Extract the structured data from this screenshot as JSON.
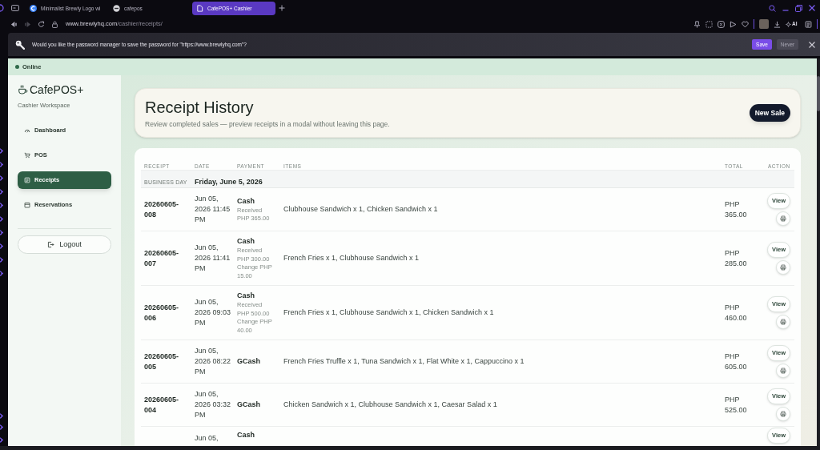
{
  "browser": {
    "tabs": [
      {
        "title": "Minimalist Brewly Logo wi",
        "selected": false
      },
      {
        "title": "cafepos",
        "selected": false
      },
      {
        "title": "CafePOS+ Cashier",
        "selected": true
      }
    ],
    "address": {
      "host": "www.brewlyhq.com",
      "path": "/cashier/receipts/"
    },
    "toolbar": {
      "ai_label": "AI"
    }
  },
  "password_prompt": {
    "message": "Would you like the password manager to save the password for \"https://www.brewlyhq.com\"?",
    "save": "Save",
    "never": "Never"
  },
  "status_bar": {
    "label": "Online"
  },
  "sidebar": {
    "brand": "CafePOS+",
    "subtitle": "Cashier Workspace",
    "items": [
      {
        "label": "Dashboard",
        "selected": false
      },
      {
        "label": "POS",
        "selected": false
      },
      {
        "label": "Receipts",
        "selected": true
      },
      {
        "label": "Reservations",
        "selected": false
      }
    ],
    "logout": "Logout"
  },
  "header": {
    "title": "Receipt History",
    "subtitle": "Review completed sales — preview receipts in a modal without leaving this page.",
    "button": "New Sale"
  },
  "table": {
    "columns": [
      "RECEIPT",
      "DATE",
      "PAYMENT",
      "ITEMS",
      "TOTAL",
      "ACTION"
    ],
    "group": {
      "label": "BUSINESS DAY",
      "date": "Friday, June 5, 2026"
    },
    "rows": [
      {
        "receipt": "20260605-008",
        "date": "Jun 05, 2026 11:45 PM",
        "payment": {
          "method": "Cash",
          "received": "Received PHP 365.00"
        },
        "items": "Clubhouse Sandwich x 1, Chicken Sandwich x 1",
        "total": "PHP 365.00",
        "action": "View"
      },
      {
        "receipt": "20260605-007",
        "date": "Jun 05, 2026 11:41 PM",
        "payment": {
          "method": "Cash",
          "received": "Received PHP 300.00",
          "change": "Change PHP 15.00"
        },
        "items": "French Fries x 1, Clubhouse Sandwich x 1",
        "total": "PHP 285.00",
        "action": "View"
      },
      {
        "receipt": "20260605-006",
        "date": "Jun 05, 2026 09:03 PM",
        "payment": {
          "method": "Cash",
          "received": "Received PHP 500.00",
          "change": "Change PHP 40.00"
        },
        "items": "French Fries x 1, Clubhouse Sandwich x 1, Chicken Sandwich x 1",
        "total": "PHP 460.00",
        "action": "View"
      },
      {
        "receipt": "20260605-005",
        "date": "Jun 05, 2026 08:22 PM",
        "payment": {
          "method": "GCash"
        },
        "items": "French Fries Truffle x 1, Tuna Sandwich x 1, Flat White x 1, Cappuccino x 1",
        "total": "PHP 605.00",
        "action": "View"
      },
      {
        "receipt": "20260605-004",
        "date": "Jun 05, 2026 03:32 PM",
        "payment": {
          "method": "GCash"
        },
        "items": "Chicken Sandwich x 1, Clubhouse Sandwich x 1, Caesar Salad x 1",
        "total": "PHP 525.00",
        "action": "View"
      },
      {
        "date": "Jun 05,",
        "payment": {
          "method": "Cash"
        },
        "action": "View"
      }
    ]
  }
}
